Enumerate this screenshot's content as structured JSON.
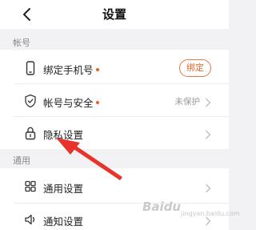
{
  "header": {
    "title": "设置",
    "back_icon": "chevron-left-icon"
  },
  "sections": {
    "account": {
      "label": "帐号",
      "rows": [
        {
          "label": "绑定手机号",
          "icon": "phone-icon",
          "has_dot": true,
          "action_label": "绑定"
        },
        {
          "label": "帐号与安全",
          "icon": "shield-icon",
          "has_dot": true,
          "status": "未保护"
        },
        {
          "label": "隐私设置",
          "icon": "lock-icon",
          "has_dot": false
        }
      ]
    },
    "general": {
      "label": "通用",
      "rows": [
        {
          "label": "通用设置",
          "icon": "grid-icon"
        },
        {
          "label": "通知设置",
          "icon": "speaker-icon"
        }
      ]
    }
  },
  "watermark": {
    "brand": "Baidu",
    "sub": "jingyan.baidu.com"
  },
  "colors": {
    "accent": "#e8612a",
    "arrow": "#e8332a"
  }
}
